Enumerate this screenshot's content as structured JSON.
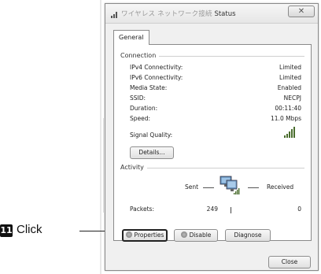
{
  "window": {
    "title_prefix": "ワイヤレス ネットワーク接続",
    "title_suffix": "Status",
    "close_glyph": "✕"
  },
  "tabs": [
    {
      "label": "General"
    }
  ],
  "connection": {
    "group_label": "Connection",
    "rows": [
      {
        "label": "IPv4 Connectivity:",
        "value": "Limited"
      },
      {
        "label": "IPv6 Connectivity:",
        "value": "Limited"
      },
      {
        "label": "Media State:",
        "value": "Enabled"
      },
      {
        "label": "SSID:",
        "value": "NECPJ"
      },
      {
        "label": "Duration:",
        "value": "00:11:40"
      },
      {
        "label": "Speed:",
        "value": "11.0 Mbps"
      }
    ],
    "signal_label": "Signal Quality:",
    "details_button": "Details..."
  },
  "activity": {
    "group_label": "Activity",
    "sent_label": "Sent",
    "received_label": "Received",
    "packets_label": "Packets:",
    "packets_sent": "249",
    "packets_received": "0"
  },
  "buttons": {
    "properties": "Properties",
    "disable": "Disable",
    "diagnose": "Diagnose",
    "close": "Close"
  },
  "annotation": {
    "step_number": "11",
    "step_text": "Click"
  }
}
